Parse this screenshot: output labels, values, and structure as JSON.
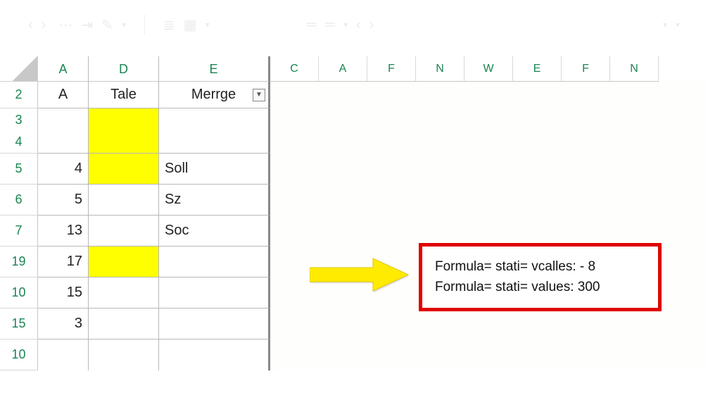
{
  "toolbar": {
    "nav_back": "‹",
    "nav_fwd": "›",
    "sep_dots": "⋯",
    "caret": "▾"
  },
  "columns": {
    "frozen": [
      "A",
      "D",
      "E"
    ],
    "rest": [
      "C",
      "A",
      "F",
      "N",
      "W",
      "E",
      "F",
      "N"
    ]
  },
  "header_row": {
    "row_num": "2",
    "A": "A",
    "D": "Tale",
    "E": "Merrge"
  },
  "rows": [
    {
      "num": "3",
      "A": "",
      "D_yellow": true,
      "E": "",
      "merged_with_next": true
    },
    {
      "num": "4",
      "A": "",
      "D_yellow": true,
      "E": ""
    },
    {
      "num": "5",
      "A": "4",
      "D_yellow": true,
      "E": "Soll"
    },
    {
      "num": "6",
      "A": "5",
      "D_yellow": false,
      "E": "Sz"
    },
    {
      "num": "7",
      "A": "13",
      "D_yellow": false,
      "E": "Soc"
    },
    {
      "num": "19",
      "A": "17",
      "D_yellow": true,
      "E": ""
    },
    {
      "num": "10",
      "A": "15",
      "D_yellow": false,
      "E": ""
    },
    {
      "num": "15",
      "A": "3",
      "D_yellow": false,
      "E": ""
    },
    {
      "num": "10",
      "A": "",
      "D_yellow": false,
      "E": ""
    }
  ],
  "annotation": {
    "line1": "Formula= stati= vcalles: - 8",
    "line2": "Formula= stati= values: 300"
  }
}
